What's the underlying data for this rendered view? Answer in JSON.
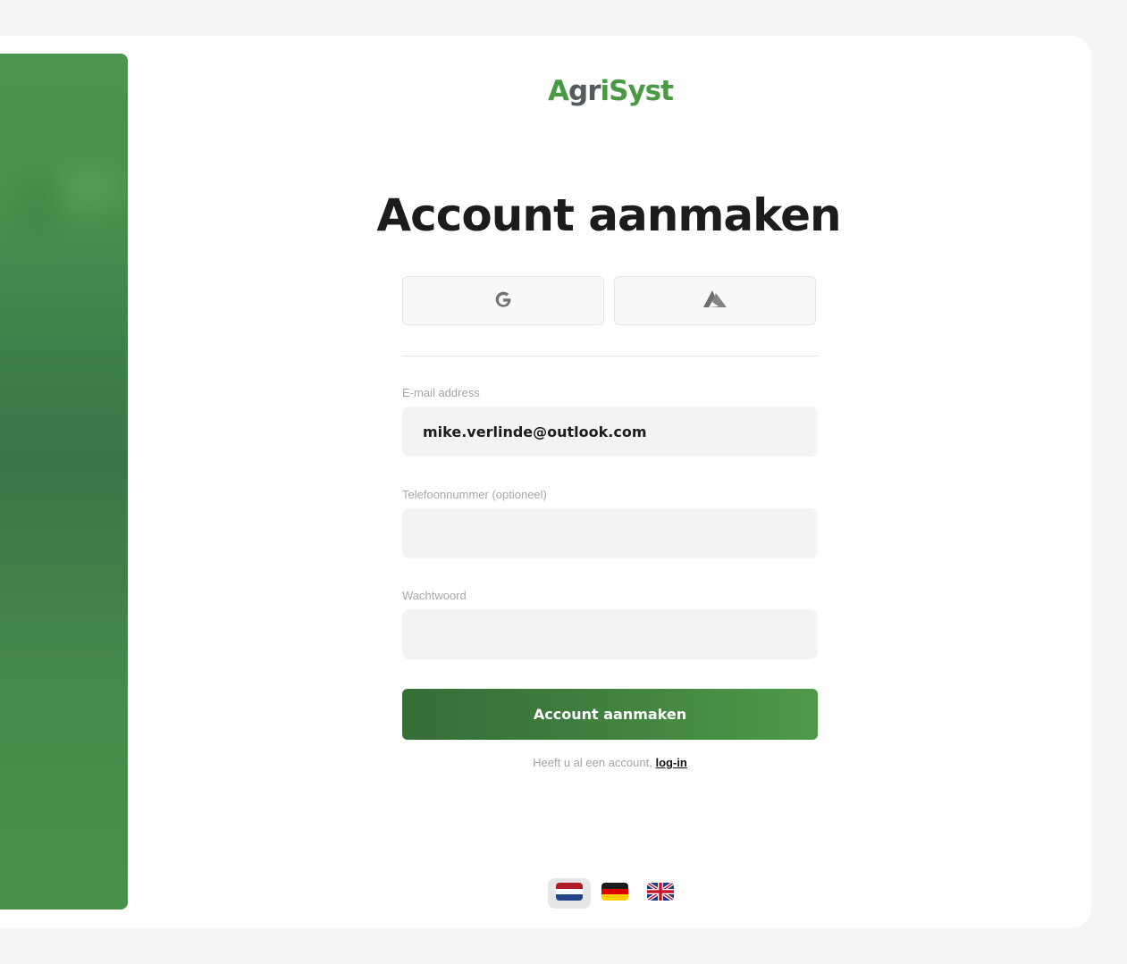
{
  "brand": {
    "part1": "A",
    "part2": "gr",
    "part3": "i",
    "part4": "Syst",
    "color_primary": "#4a9a44",
    "color_secondary": "#555a5c"
  },
  "page_title": "Account aanmaken",
  "social": {
    "google_icon": "google-g-icon",
    "azure_icon": "azure-icon"
  },
  "form": {
    "email_label": "E-mail address",
    "email_value": "mike.verlinde@outlook.com",
    "phone_label": "Telefoonnummer (optioneel)",
    "phone_value": "",
    "password_label": "Wachtwoord",
    "password_value": "",
    "submit_label": "Account aanmaken"
  },
  "login_prompt": {
    "text": "Heeft u al een account, ",
    "link": "log-in"
  },
  "languages": [
    {
      "code": "nl",
      "icon": "flag-nl-icon",
      "selected": true
    },
    {
      "code": "de",
      "icon": "flag-de-icon",
      "selected": false
    },
    {
      "code": "en",
      "icon": "flag-gb-icon",
      "selected": false
    }
  ],
  "colors": {
    "accent": "#4a9a44",
    "button_dark": "#356e37",
    "button_light": "#4f9a48",
    "side_panel": "#3f7f48"
  }
}
